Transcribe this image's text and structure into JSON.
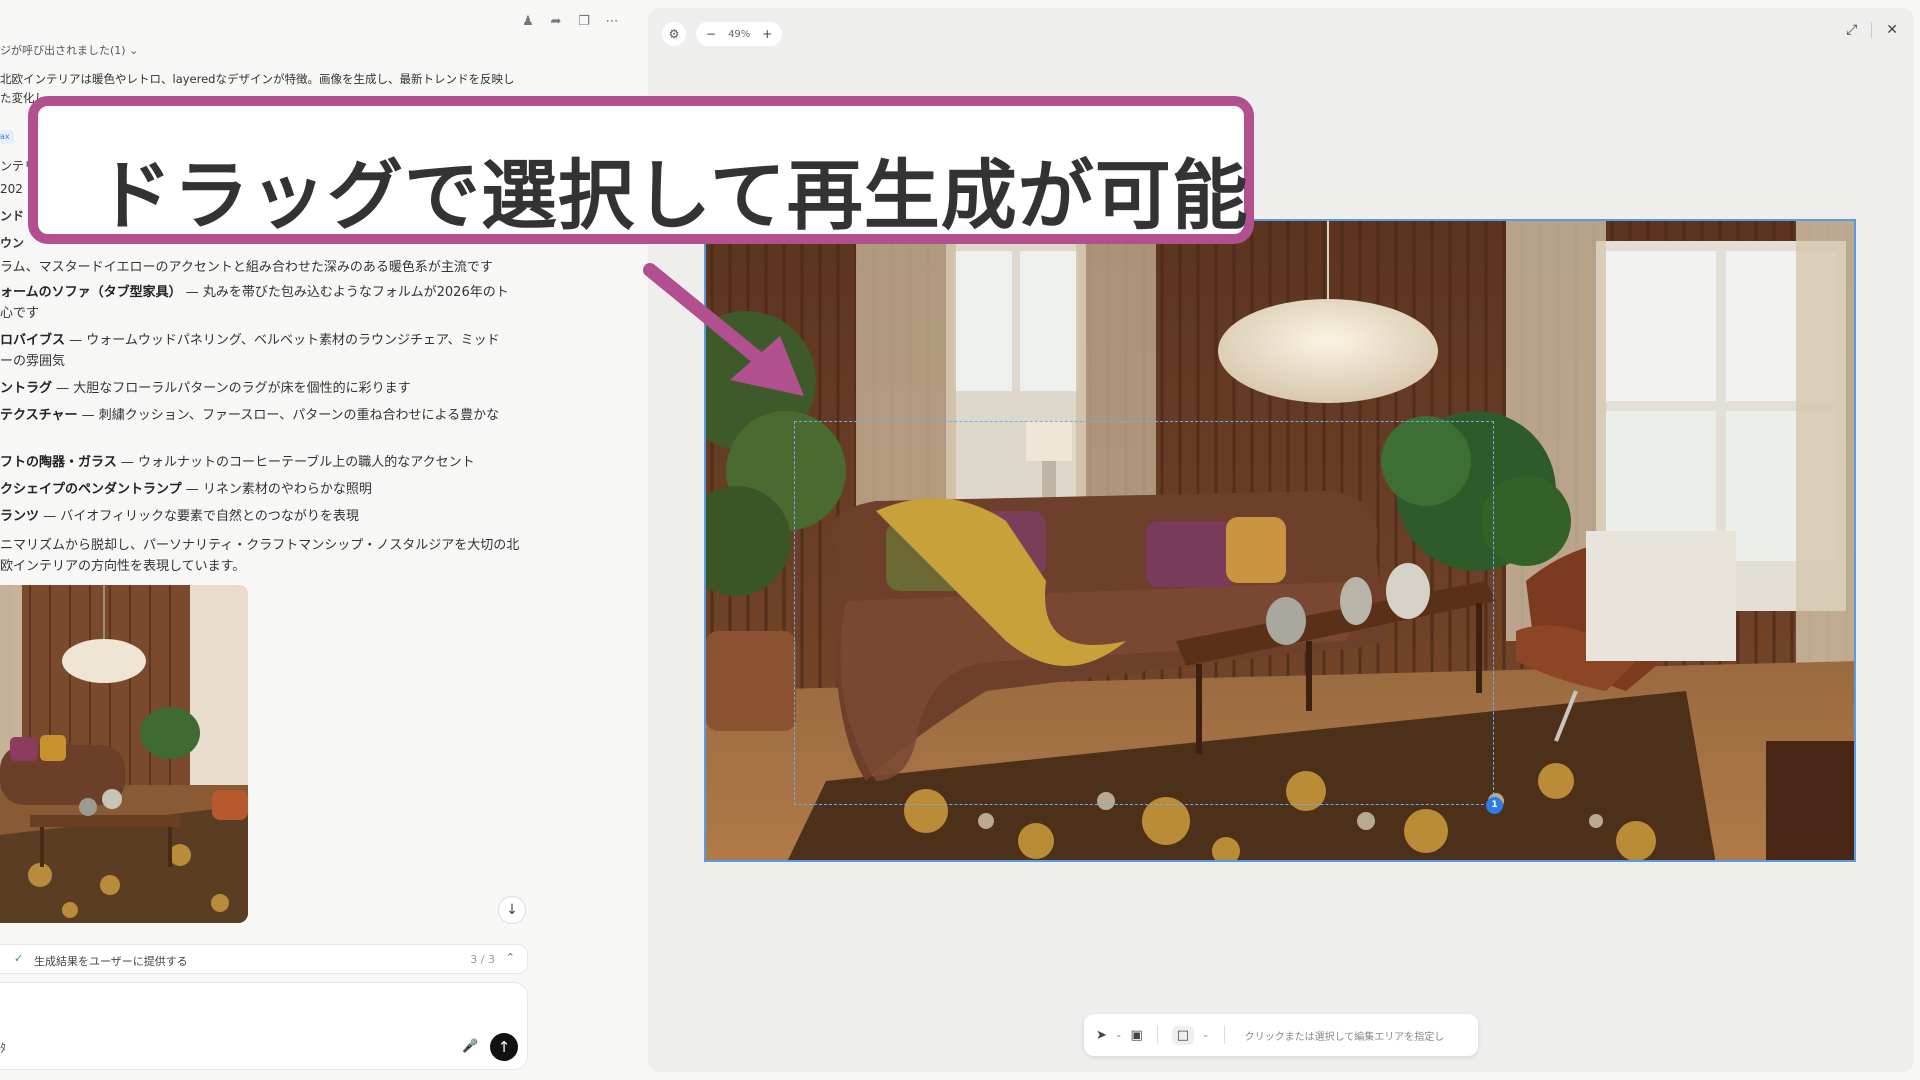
{
  "chat": {
    "actions": [
      "person-icon",
      "share-icon",
      "copy-icon",
      "more-icon"
    ],
    "tool_toggle": "ジが呼び出されました(1)",
    "summary": "北欧インテリアは暖色やレトロ、layeredなデザインが特徴。画像を生成し、最新トレンドを反映した変化し",
    "chip": "ax",
    "fragments": [
      "ンテリ",
      "202",
      "ンド",
      "ウン"
    ],
    "fragment_top_line": "ラム、マスタードイエローのアクセントと組み合わせた深みのある暖色系が主流です",
    "bullets": [
      {
        "title": "ォームのソファ（タブ型家具）",
        "text": " — 丸みを帯びた包み込むようなフォルムが2026年のト",
        "cont": "心です"
      },
      {
        "title": "ロバイブス",
        "text": " — ウォームウッドパネリング、ベルベット素材のラウンジチェア、ミッド",
        "cont": "ーの雰囲気"
      },
      {
        "title": "ントラグ",
        "text": " — 大胆なフローラルパターンのラグが床を個性的に彩ります",
        "cont": ""
      },
      {
        "title": "テクスチャー",
        "text": " — 刺繍クッション、ファースロー、パターンの重ね合わせによる豊かな",
        "cont": ""
      },
      {
        "title": "フトの陶器・ガラス",
        "text": " — ウォルナットのコーヒーテーブル上の職人的なアクセント",
        "cont": ""
      },
      {
        "title": "クシェイプのペンダントランプ",
        "text": " — リネン素材のやわらかな照明",
        "cont": ""
      },
      {
        "title": "ランツ",
        "text": " — バイオフィリックな要素で自然とのつながりを表現",
        "cont": ""
      }
    ],
    "closing": "ニマリズムから脱却し、パーソナリティ・クラフトマンシップ・ノスタルジアを大切の北欧インテリアの方向性を表現しています。",
    "progress": {
      "label": "生成結果をユーザーに提供する",
      "count": "3 / 3"
    },
    "composer": {
      "attach": "ﾀ"
    }
  },
  "canvas": {
    "zoom": "49%",
    "toolbar_hint": "クリックまたは選択して編集エリアを指定し",
    "selection_number": "1"
  },
  "callout": {
    "text": "ドラッグで選択して再生成が可能",
    "color": "#b2508f"
  }
}
